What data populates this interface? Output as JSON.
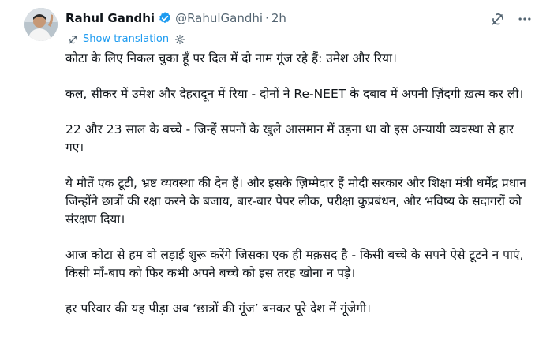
{
  "author": {
    "display_name": "Rahul Gandhi",
    "handle": "@RahulGandhi",
    "separator": "·",
    "time": "2h",
    "verified_color": "#1d9bf0"
  },
  "icons": {
    "verified": "verified-badge-icon",
    "grok": "grok-icon",
    "more": "more-options-icon",
    "translate": "translate-icon",
    "settings": "settings-gear-icon"
  },
  "translation": {
    "label": "Show translation"
  },
  "post": {
    "paragraphs": [
      "कोटा के लिए निकल चुका हूँ पर दिल में दो नाम गूंज रहे हैं: उमेश और रिया।",
      "कल, सीकर में उमेश और देहरादून में रिया - दोनों ने Re-NEET के दबाव में अपनी ज़िंदगी ख़त्म कर ली।",
      "22 और 23 साल के बच्चे - जिन्हें सपनों के खुले आसमान में उड़ना था वो इस अन्यायी व्यवस्था से हार गए।",
      "ये मौतें एक टूटी, भ्रष्ट व्यवस्था की देन हैं। और इसके ज़िम्मेदार हैं मोदी सरकार और शिक्षा मंत्री धर्मेंद्र प्रधान जिन्होंने छात्रों की रक्षा करने के बजाय, बार-बार पेपर लीक, परीक्षा कुप्रबंधन, और भविष्य के सदागरों को संरक्षण दिया।",
      "आज कोटा से हम वो लड़ाई शुरू करेंगे जिसका एक ही मक़सद है  - किसी बच्चे के सपने ऐसे टूटने न पाएं, किसी माँ-बाप को फिर कभी अपने बच्चे को इस तरह खोना न पड़े।",
      "हर परिवार की यह पीड़ा अब ‘छात्रों की गूंज’ बनकर पूरे देश में गूंजेगी।"
    ]
  }
}
